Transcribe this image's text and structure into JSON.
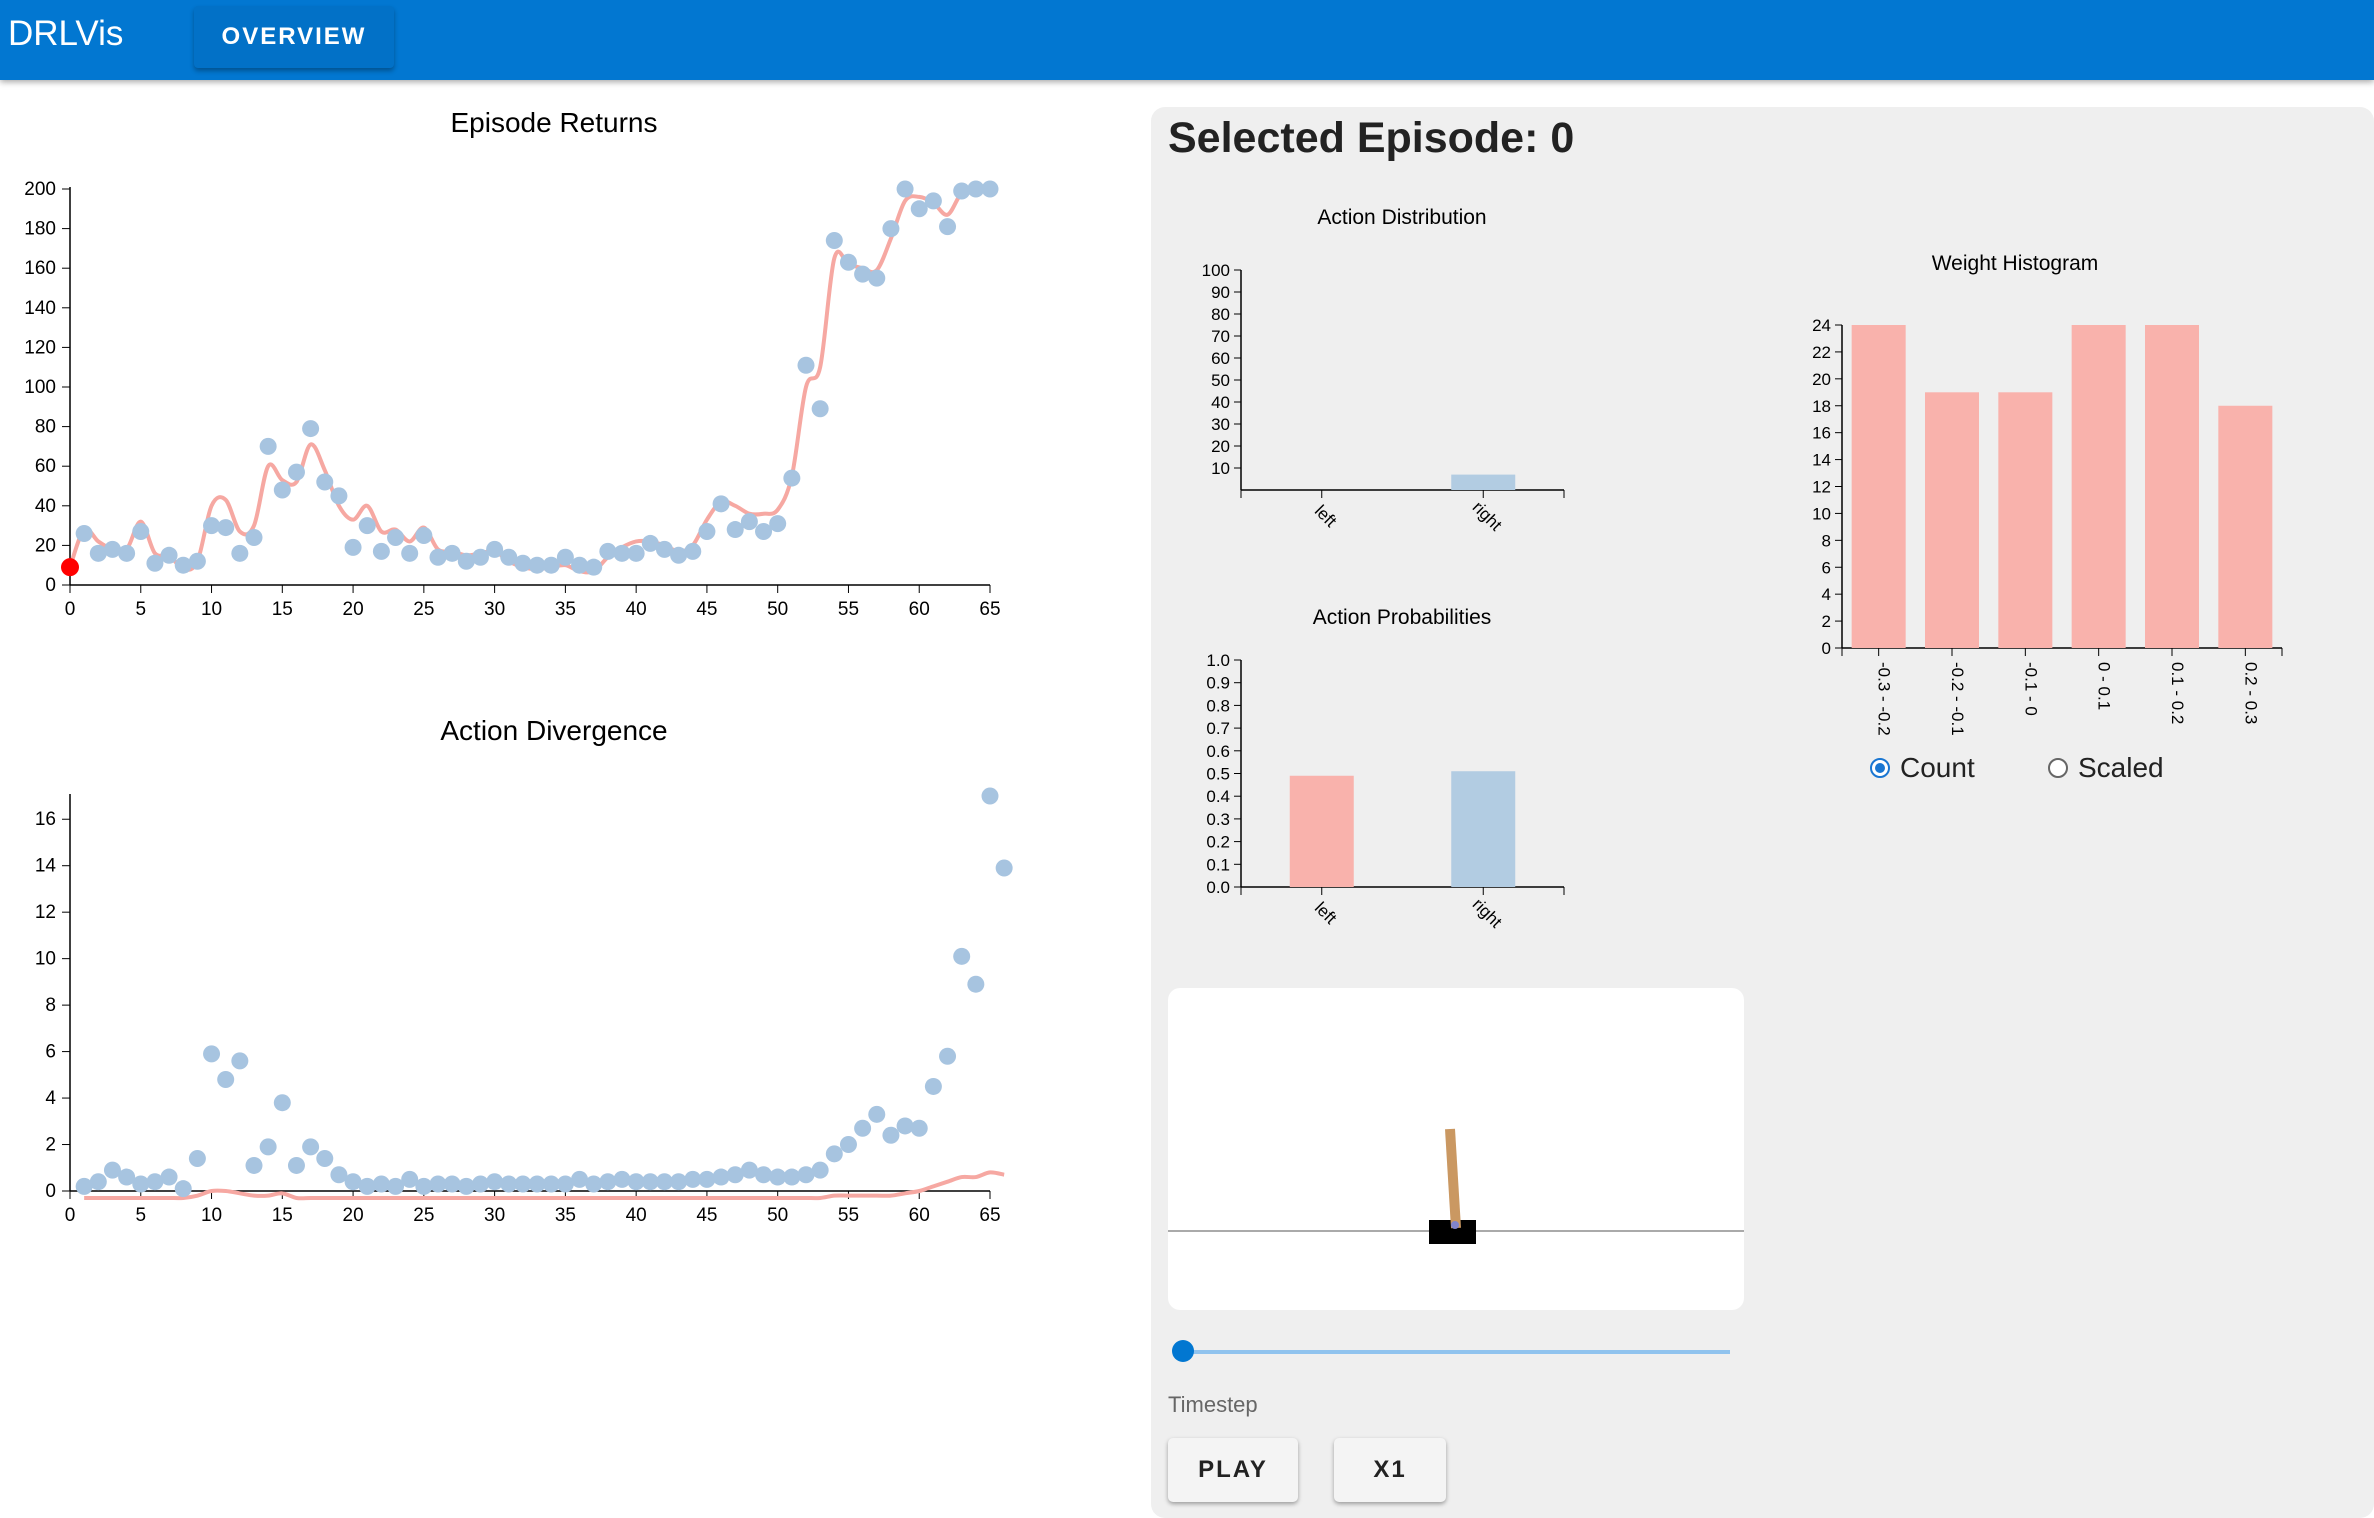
{
  "app": {
    "title": "DRLVis",
    "nav_overview": "OVERVIEW"
  },
  "colors": {
    "accent": "#0277d1",
    "points": "#a7c4e0",
    "smooth": "#f6a8a2",
    "bar_red": "#f9b2ac",
    "bar_blue": "#b2cce2",
    "selected": "#ff0000"
  },
  "selected_episode": {
    "title": "Selected Episode: 0"
  },
  "controls": {
    "timestep_label": "Timestep",
    "timestep_value": 0,
    "play_label": "PLAY",
    "speed_label": "X1"
  },
  "histogram_mode": {
    "count_label": "Count",
    "scaled_label": "Scaled",
    "selected": "Count"
  },
  "icons": {
    "cart": "cartpole-render"
  },
  "chart_data": [
    {
      "id": "returns",
      "type": "scatter",
      "title": "Episode Returns",
      "xlim": [
        0,
        65
      ],
      "ylim": [
        0,
        200
      ],
      "xticks": [
        0,
        5,
        10,
        15,
        20,
        25,
        30,
        35,
        40,
        45,
        50,
        55,
        60,
        65
      ],
      "yticks": [
        0,
        20,
        40,
        60,
        80,
        100,
        120,
        140,
        160,
        180,
        200
      ],
      "x_start": 0,
      "values": [
        9,
        26,
        16,
        18,
        16,
        27,
        11,
        15,
        10,
        12,
        30,
        29,
        16,
        24,
        70,
        48,
        57,
        79,
        52,
        45,
        19,
        30,
        17,
        24,
        16,
        25,
        14,
        16,
        12,
        14,
        18,
        14,
        11,
        10,
        10,
        14,
        10,
        9,
        17,
        16,
        16,
        21,
        18,
        15,
        17,
        27,
        41,
        28,
        32,
        27,
        31,
        54,
        111,
        89,
        174,
        163,
        157,
        155,
        180,
        200,
        190,
        194,
        181,
        199,
        200,
        200
      ],
      "smooth": [
        9,
        28,
        22,
        18,
        18,
        32,
        16,
        15,
        8,
        12,
        40,
        43,
        27,
        30,
        60,
        53,
        52,
        71,
        58,
        40,
        33,
        40,
        27,
        28,
        22,
        29,
        18,
        17,
        15,
        16,
        17,
        12,
        9,
        8,
        9,
        10,
        7,
        7,
        14,
        19,
        22,
        22,
        20,
        17,
        20,
        33,
        42,
        40,
        36,
        36,
        38,
        55,
        100,
        110,
        165,
        162,
        160,
        159,
        175,
        194,
        196,
        193,
        187,
        198,
        200,
        200
      ],
      "selected_index": 0
    },
    {
      "id": "divergence",
      "type": "scatter",
      "title": "Action Divergence",
      "xlim": [
        0,
        65
      ],
      "ylim": [
        0,
        17
      ],
      "xticks": [
        0,
        5,
        10,
        15,
        20,
        25,
        30,
        35,
        40,
        45,
        50,
        55,
        60,
        65
      ],
      "yticks": [
        0,
        2,
        4,
        6,
        8,
        10,
        12,
        14,
        16
      ],
      "x_start": 1,
      "values": [
        0.2,
        0.4,
        0.9,
        0.6,
        0.3,
        0.4,
        0.6,
        0.1,
        1.4,
        5.9,
        4.8,
        5.6,
        1.1,
        1.9,
        3.8,
        1.1,
        1.9,
        1.4,
        0.7,
        0.4,
        0.2,
        0.3,
        0.2,
        0.5,
        0.2,
        0.3,
        0.3,
        0.2,
        0.3,
        0.4,
        0.3,
        0.3,
        0.3,
        0.3,
        0.3,
        0.5,
        0.3,
        0.4,
        0.5,
        0.4,
        0.4,
        0.4,
        0.4,
        0.5,
        0.5,
        0.6,
        0.7,
        0.9,
        0.7,
        0.6,
        0.6,
        0.7,
        0.9,
        1.6,
        2.0,
        2.7,
        3.3,
        2.4,
        2.8,
        2.7,
        4.5,
        5.8,
        10.1,
        8.9,
        17.0,
        13.9
      ],
      "smooth": [
        -0.3,
        -0.3,
        -0.3,
        -0.3,
        -0.3,
        -0.3,
        -0.3,
        -0.3,
        -0.2,
        0,
        0,
        -0.1,
        -0.2,
        -0.2,
        -0.1,
        -0.3,
        -0.3,
        -0.3,
        -0.3,
        -0.3,
        -0.3,
        -0.3,
        -0.3,
        -0.3,
        -0.3,
        -0.3,
        -0.3,
        -0.3,
        -0.3,
        -0.3,
        -0.3,
        -0.3,
        -0.3,
        -0.3,
        -0.3,
        -0.3,
        -0.3,
        -0.3,
        -0.3,
        -0.3,
        -0.3,
        -0.3,
        -0.3,
        -0.3,
        -0.3,
        -0.3,
        -0.3,
        -0.3,
        -0.3,
        -0.3,
        -0.3,
        -0.3,
        -0.3,
        -0.2,
        -0.2,
        -0.2,
        -0.2,
        -0.2,
        -0.1,
        0,
        0.2,
        0.4,
        0.6,
        0.6,
        0.8,
        0.7
      ]
    },
    {
      "id": "action_dist",
      "type": "bar",
      "title": "Action Distribution",
      "categories": [
        "left",
        "right"
      ],
      "values": [
        0,
        7
      ],
      "ylim": [
        0,
        100
      ],
      "yticks": [
        10,
        20,
        30,
        40,
        50,
        60,
        70,
        80,
        90,
        100
      ]
    },
    {
      "id": "action_prob",
      "type": "bar",
      "title": "Action Probabilities",
      "categories": [
        "left",
        "right"
      ],
      "values": [
        0.49,
        0.51
      ],
      "ylim": [
        0,
        1.0
      ],
      "yticks": [
        "0.0",
        "0.1",
        "0.2",
        "0.3",
        "0.4",
        "0.5",
        "0.6",
        "0.7",
        "0.8",
        "0.9",
        "1.0"
      ]
    },
    {
      "id": "weights",
      "type": "bar",
      "title": "Weight Histogram",
      "categories": [
        "-0.3 - -0.2",
        "-0.2 - -0.1",
        "-0.1 - 0",
        "0 - 0.1",
        "0.1 - 0.2",
        "0.2 - 0.3"
      ],
      "values": [
        24,
        19,
        19,
        24,
        24,
        18
      ],
      "ylim": [
        0,
        24
      ],
      "yticks": [
        0,
        2,
        4,
        6,
        8,
        10,
        12,
        14,
        16,
        18,
        20,
        22,
        24
      ]
    }
  ]
}
